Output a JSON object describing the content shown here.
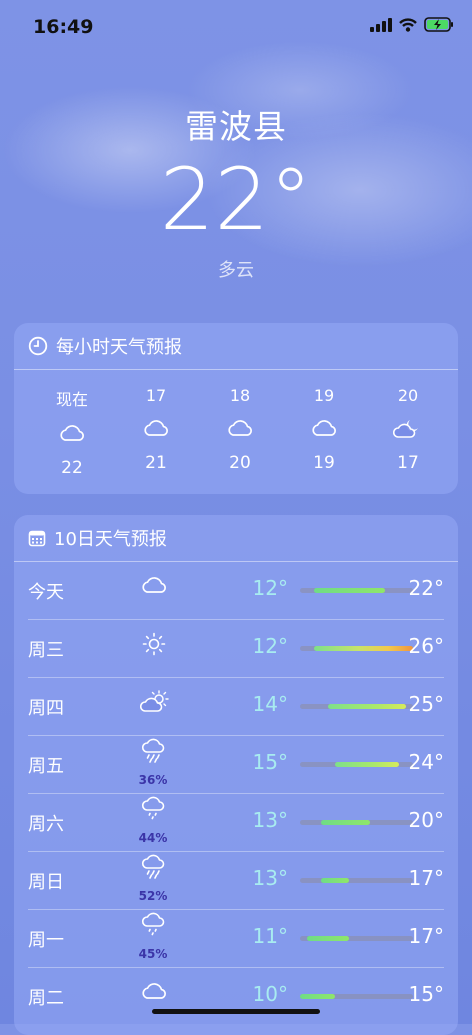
{
  "status_bar": {
    "time": "16:49"
  },
  "location": {
    "city": "雷波县",
    "temperature": "22°",
    "condition": "多云"
  },
  "hourly": {
    "title": "每小时天气预报",
    "items": [
      {
        "label": "现在",
        "icon": "cloud-icon",
        "temp": "22"
      },
      {
        "label": "17",
        "icon": "cloud-icon",
        "temp": "21"
      },
      {
        "label": "18",
        "icon": "cloud-icon",
        "temp": "20"
      },
      {
        "label": "19",
        "icon": "cloud-icon",
        "temp": "19"
      },
      {
        "label": "20",
        "icon": "cloud-moon-icon",
        "temp": "17"
      }
    ]
  },
  "daily": {
    "title": "10日天气预报",
    "days": [
      {
        "day": "今天",
        "icon": "cloud-icon",
        "precip": "",
        "low": "12°",
        "high": "22°",
        "range": [
          12,
          22
        ]
      },
      {
        "day": "周三",
        "icon": "sun-icon",
        "precip": "",
        "low": "12°",
        "high": "26°",
        "range": [
          12,
          26
        ]
      },
      {
        "day": "周四",
        "icon": "partly-sunny-icon",
        "precip": "",
        "low": "14°",
        "high": "25°",
        "range": [
          14,
          25
        ]
      },
      {
        "day": "周五",
        "icon": "rain-cloud-icon",
        "precip": "36%",
        "low": "15°",
        "high": "24°",
        "range": [
          15,
          24
        ]
      },
      {
        "day": "周六",
        "icon": "drizzle-cloud-icon",
        "precip": "44%",
        "low": "13°",
        "high": "20°",
        "range": [
          13,
          20
        ]
      },
      {
        "day": "周日",
        "icon": "rain-cloud-icon",
        "precip": "52%",
        "low": "13°",
        "high": "17°",
        "range": [
          13,
          17
        ]
      },
      {
        "day": "周一",
        "icon": "drizzle-cloud-icon",
        "precip": "45%",
        "low": "11°",
        "high": "17°",
        "range": [
          11,
          17
        ]
      },
      {
        "day": "周二",
        "icon": "cloud-icon",
        "precip": "",
        "low": "10°",
        "high": "15°",
        "range": [
          10,
          15
        ]
      }
    ],
    "scale": [
      10,
      26
    ]
  },
  "colors": {
    "low_text": "#a8ecf0",
    "bar_track": "#8c8ca0",
    "precip_text": "#3b35a8"
  }
}
